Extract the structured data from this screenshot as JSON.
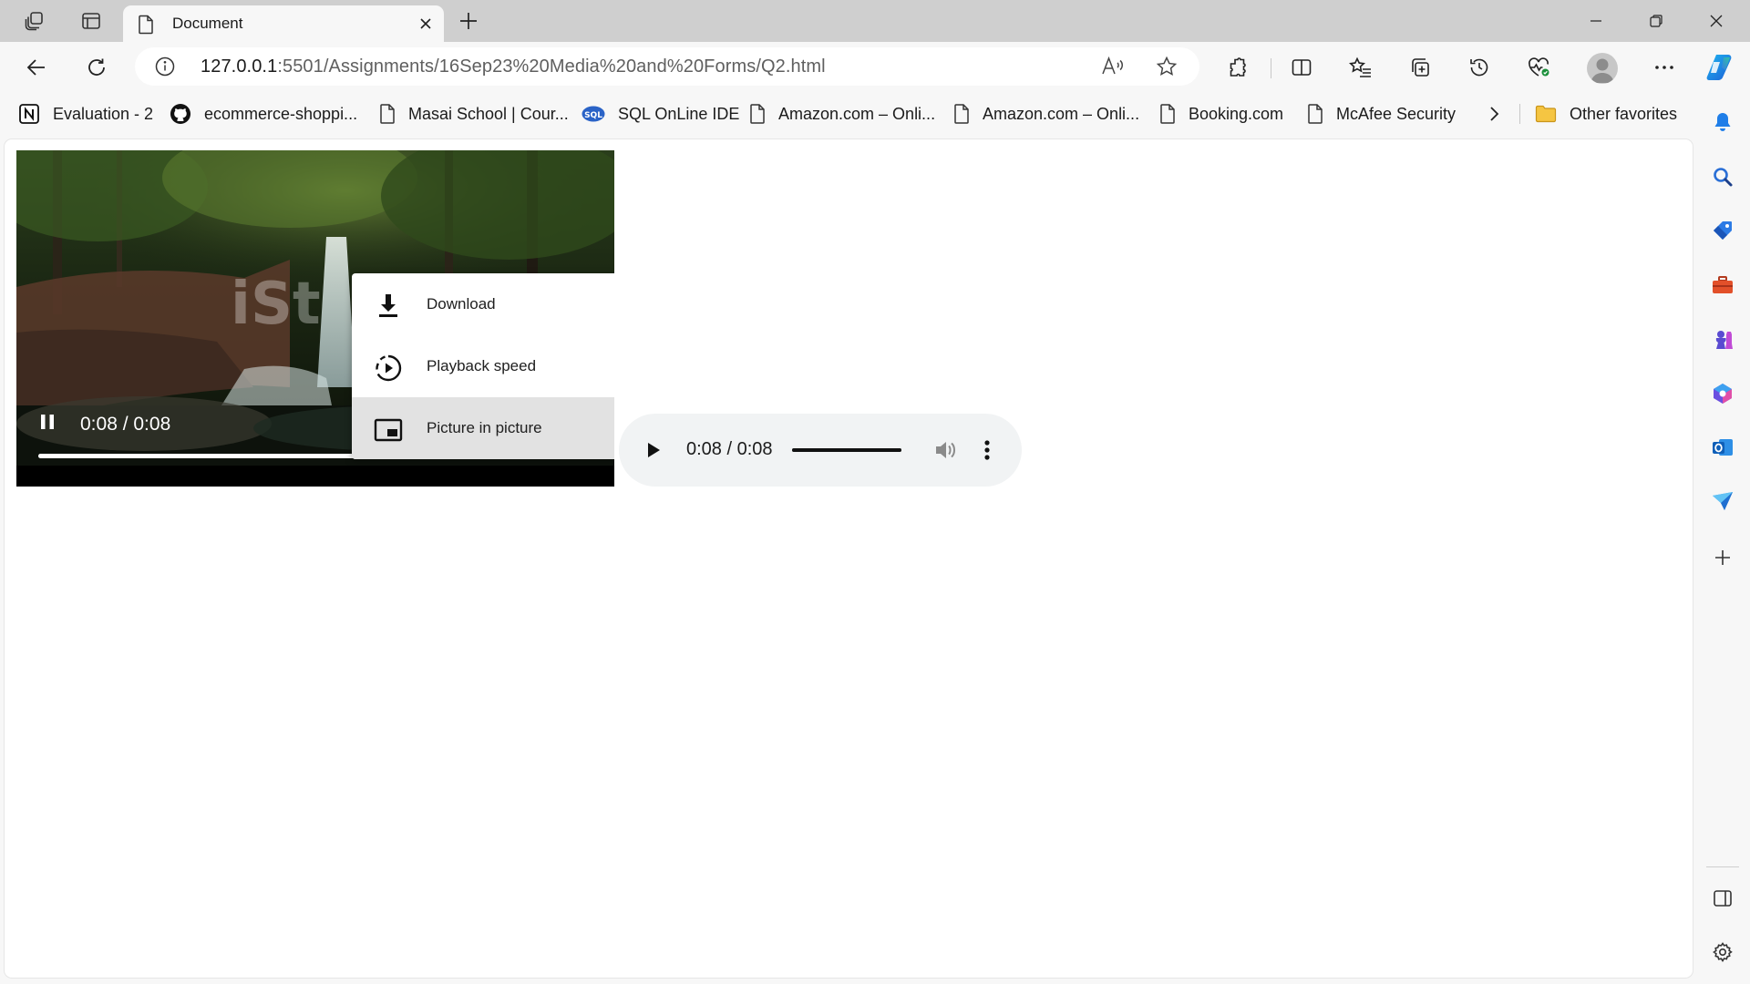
{
  "tabstrip": {
    "tab_title": "Document",
    "tab_icon": "page-icon"
  },
  "toolbar": {
    "url_host": "127.0.0.1",
    "url_path": ":5501/Assignments/16Sep23%20Media%20and%20Forms/Q2.html"
  },
  "favorites": {
    "items": [
      {
        "label": "Evaluation - 2",
        "icon": "notion-icon"
      },
      {
        "label": "ecommerce-shoppi...",
        "icon": "github-icon"
      },
      {
        "label": "Masai School | Cour...",
        "icon": "page-icon"
      },
      {
        "label": "SQL OnLine IDE",
        "icon": "sql-icon"
      },
      {
        "label": "Amazon.com – Onli...",
        "icon": "page-icon"
      },
      {
        "label": "Amazon.com – Onli...",
        "icon": "page-icon"
      },
      {
        "label": "Booking.com",
        "icon": "page-icon"
      },
      {
        "label": "McAfee Security",
        "icon": "page-icon"
      }
    ],
    "other_favorites": "Other favorites"
  },
  "video": {
    "time": "0:08 / 0:08",
    "progress": 0.93,
    "watermark": "iSt"
  },
  "context_menu": {
    "items": [
      {
        "label": "Download",
        "icon": "download-icon"
      },
      {
        "label": "Playback speed",
        "icon": "playback-speed-icon"
      },
      {
        "label": "Picture in picture",
        "icon": "picture-in-picture-icon",
        "highlighted": true
      }
    ]
  },
  "audio": {
    "time": "0:08 / 0:08",
    "progress": 1.0
  },
  "colors": {
    "chrome_bg": "#f7f7f7",
    "tabstrip_bg": "#cfcfcf",
    "audio_bg": "#f1f3f4",
    "menu_highlight": "#e2e2e2"
  }
}
